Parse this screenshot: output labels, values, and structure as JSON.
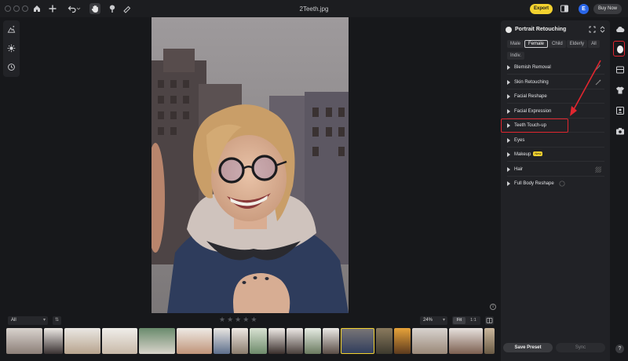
{
  "window": {
    "title": "2Teeth.jpg"
  },
  "toolbar": {
    "export_label": "Export",
    "avatar_initial": "E",
    "buy_label": "Buy Now"
  },
  "panel": {
    "title": "Portrait Retouching",
    "tabs": [
      {
        "label": "Male",
        "active": false
      },
      {
        "label": "Female",
        "active": true
      },
      {
        "label": "Child",
        "active": false
      },
      {
        "label": "Elderly",
        "active": false
      },
      {
        "label": "All",
        "active": false
      },
      {
        "label": "Indiv.",
        "active": false
      }
    ],
    "features": [
      {
        "label": "Blemish Removal",
        "icon": "magic-wand-icon"
      },
      {
        "label": "Skin Retouching",
        "icon": "brush-icon"
      },
      {
        "label": "Facial Reshape"
      },
      {
        "label": "Facial Expression"
      },
      {
        "label": "Teeth Touch-up",
        "highlighted": true
      },
      {
        "label": "Eyes"
      },
      {
        "label": "Makeup",
        "badge": "New"
      },
      {
        "label": "Hair",
        "icon": "hatch-brush-icon"
      },
      {
        "label": "Full Body Reshape",
        "icon": "info-icon"
      }
    ],
    "save_preset_label": "Save Preset",
    "sync_label": "Sync"
  },
  "bottom": {
    "filter_value": "All",
    "zoom_value": "24%",
    "fit_label": "Fit",
    "one_to_one_label": "1:1",
    "rating_stars": 5
  },
  "help_label": "?",
  "colors": {
    "accent": "#f3d22f",
    "annotation": "#e0262f",
    "avatar": "#2a66e8"
  }
}
